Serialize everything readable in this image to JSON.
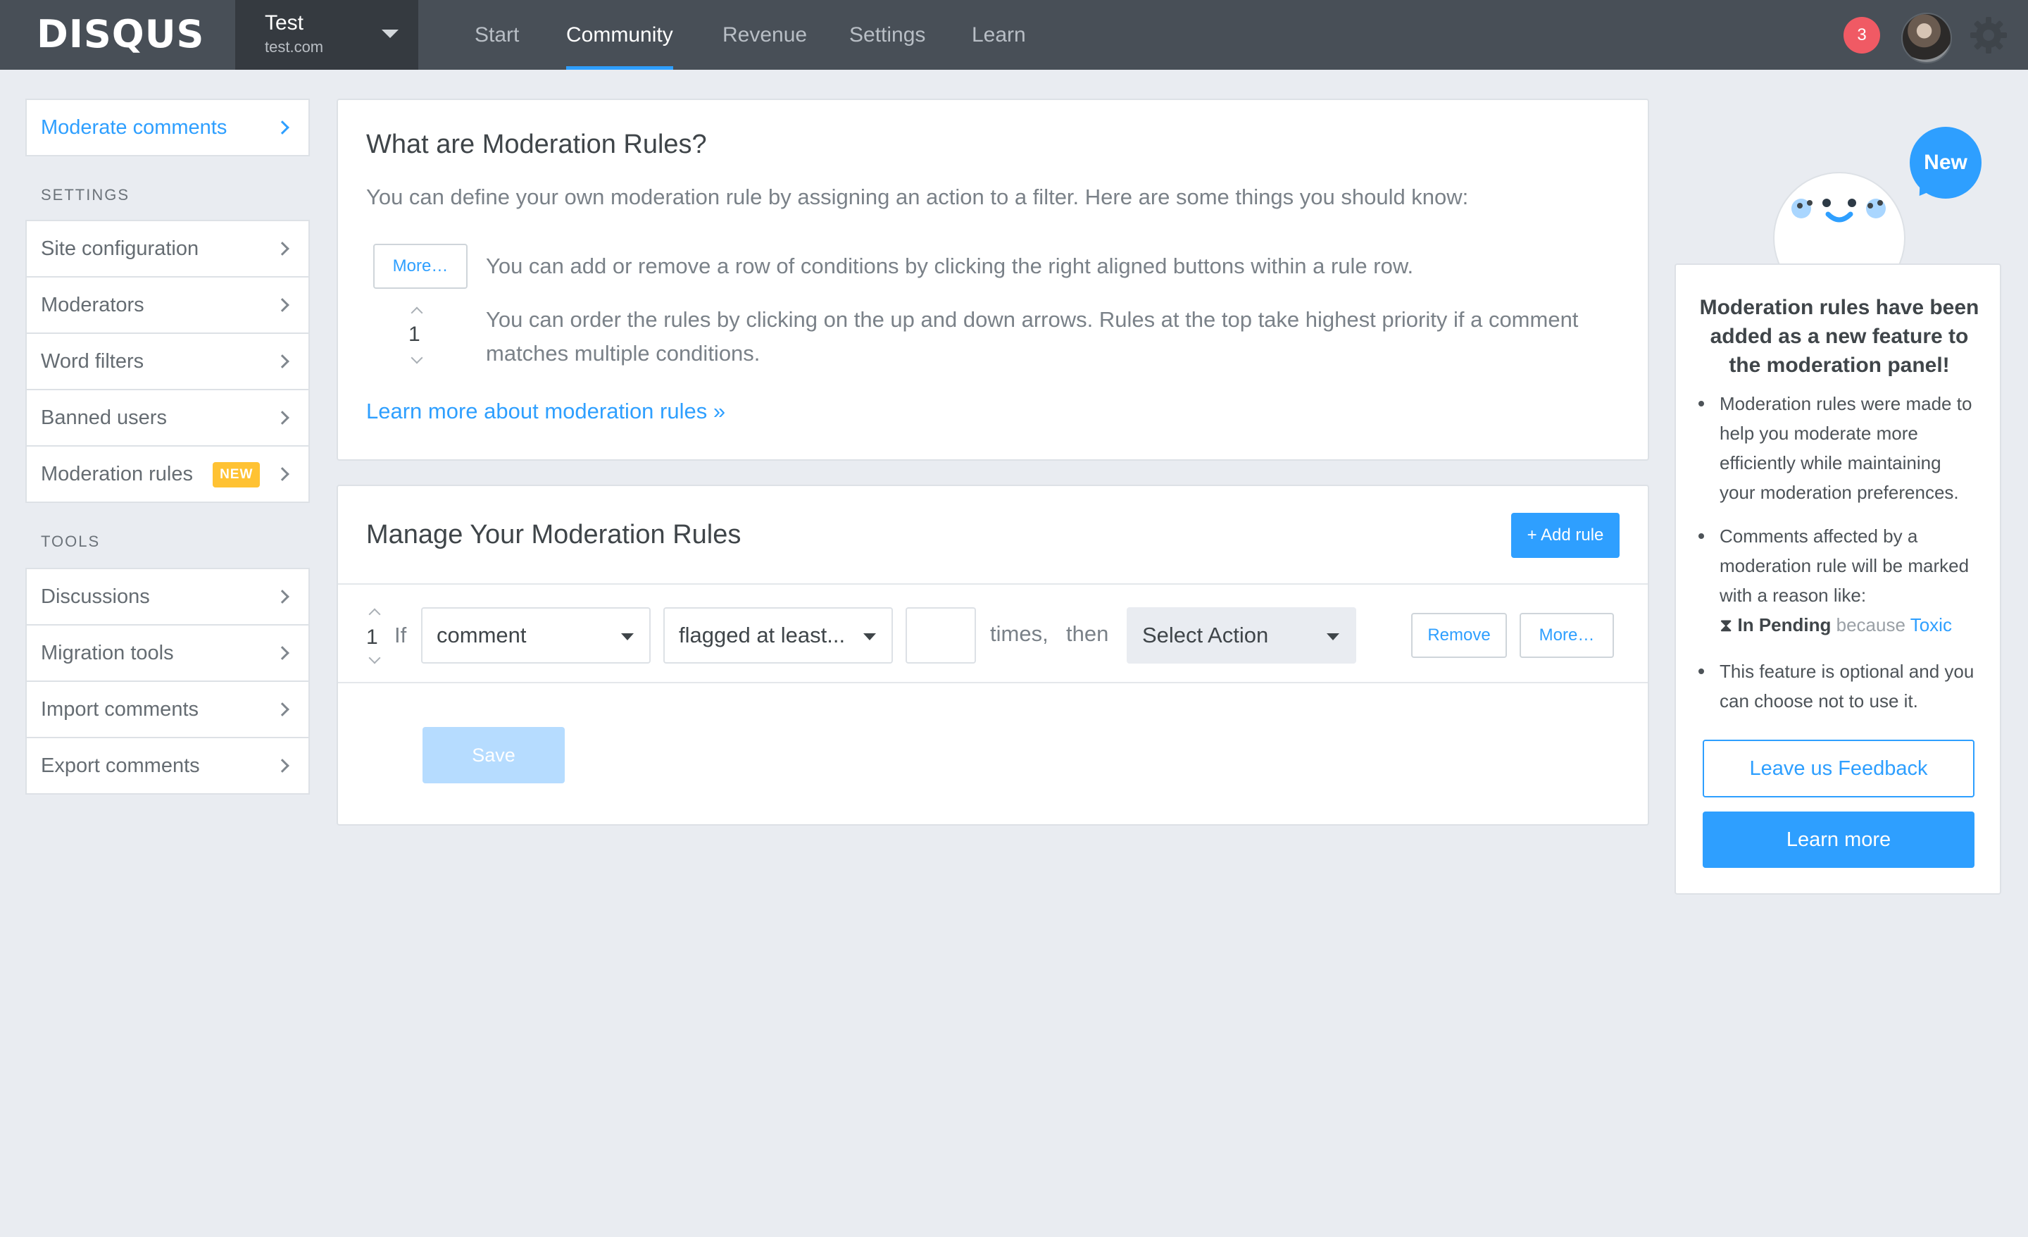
{
  "topbar": {
    "logo": "DISQUS",
    "site": {
      "name": "Test",
      "url": "test.com"
    },
    "tabs": [
      {
        "label": "Start"
      },
      {
        "label": "Community"
      },
      {
        "label": "Revenue"
      },
      {
        "label": "Settings"
      },
      {
        "label": "Learn"
      }
    ],
    "notification_count": "3"
  },
  "sidebar": {
    "moderate": "Moderate comments",
    "settings_heading": "SETTINGS",
    "settings_items": [
      {
        "label": "Site configuration"
      },
      {
        "label": "Moderators"
      },
      {
        "label": "Word filters"
      },
      {
        "label": "Banned users"
      },
      {
        "label": "Moderation rules",
        "badge": "NEW"
      }
    ],
    "tools_heading": "TOOLS",
    "tools_items": [
      {
        "label": "Discussions"
      },
      {
        "label": "Migration tools"
      },
      {
        "label": "Import comments"
      },
      {
        "label": "Export comments"
      }
    ]
  },
  "intro": {
    "title": "What are Moderation Rules?",
    "description": "You can define your own moderation rule by assigning an action to a filter. Here are some things you should know:",
    "more_button": "More…",
    "example_order": "1",
    "tip1": "You can add or remove a row of conditions by clicking the right aligned buttons within a rule row.",
    "tip2_line1": "You can order the rules by clicking on the up and down arrows. Rules at the top take highest priority if a comment",
    "tip2_line2": "matches multiple conditions.",
    "learn_link": "Learn more about moderation rules »"
  },
  "manage": {
    "title": "Manage Your Moderation Rules",
    "add_button": "+ Add rule",
    "rule": {
      "order": "1",
      "if_label": "If",
      "subject": "comment",
      "condition": "flagged at least...",
      "count_value": "",
      "times_label": "times,",
      "then_label": "then",
      "action_placeholder": "Select Action",
      "remove_button": "Remove",
      "more_button": "More…"
    },
    "save_button": "Save"
  },
  "promo": {
    "bubble": "New",
    "title": "Moderation rules have been added as a new feature to the moderation panel!",
    "bullet1": "Moderation rules were made to help you moderate more efficiently while maintaining your moderation preferences.",
    "bullet2_text": "Comments affected by a moderation rule will be marked with a reason like:",
    "bullet2_status": "In Pending",
    "bullet2_because": "because",
    "bullet2_reason": "Toxic",
    "bullet3": "This feature is optional and you can choose not to use it.",
    "feedback_button": "Leave us Feedback",
    "learn_button": "Learn more"
  },
  "colors": {
    "accent": "#2e9fff",
    "topbar": "#484f57",
    "badge": "#f05a64",
    "new_pill": "#ffc233",
    "background": "#e9ecf1"
  }
}
